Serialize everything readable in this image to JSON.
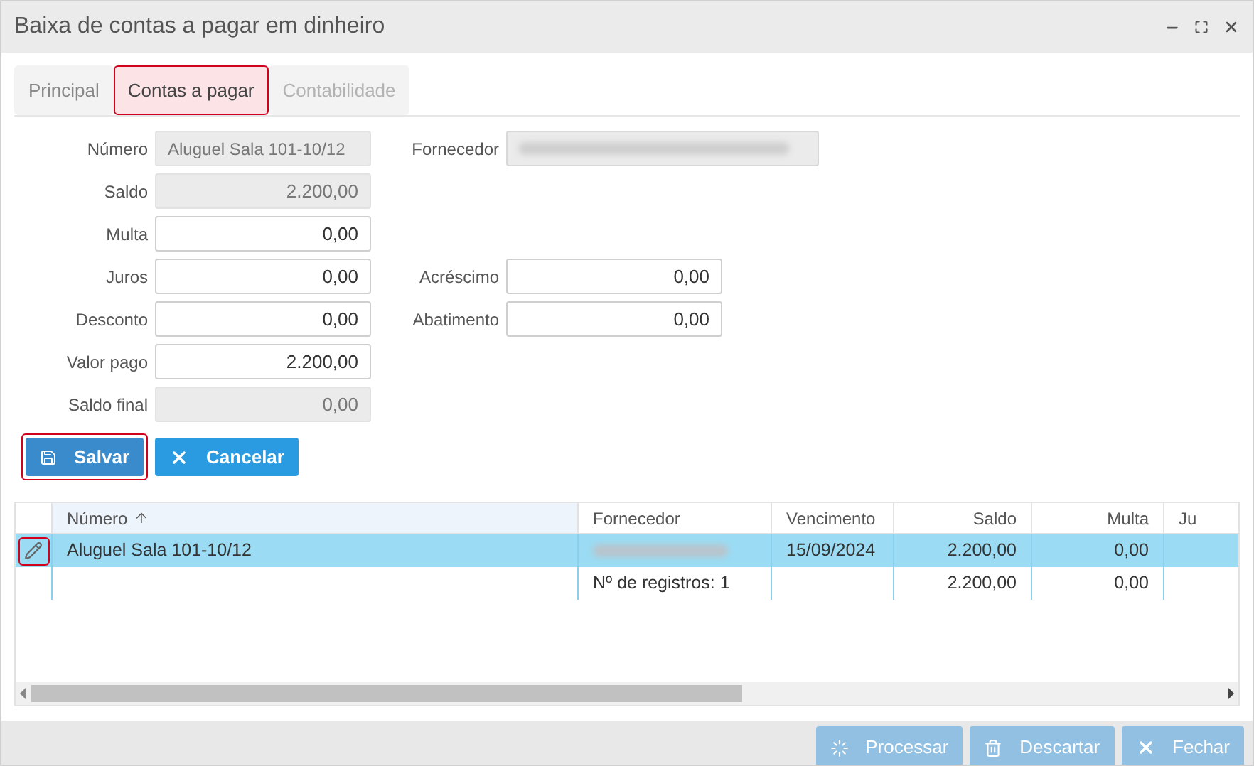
{
  "window": {
    "title": "Baixa de contas a pagar em dinheiro"
  },
  "tabs": [
    {
      "label": "Principal",
      "selected": false,
      "disabled": false,
      "highlighted": false
    },
    {
      "label": "Contas a pagar",
      "selected": true,
      "disabled": false,
      "highlighted": true
    },
    {
      "label": "Contabilidade",
      "selected": false,
      "disabled": true,
      "highlighted": false
    }
  ],
  "form_rows": [
    {
      "left": {
        "label": "Número",
        "value": "Aluguel Sala 101-10/12",
        "readonly": true
      },
      "right": {
        "label": "Fornecedor",
        "kind": "redacted",
        "readonly": true
      }
    },
    {
      "left": {
        "label": "Saldo",
        "value": "2.200,00",
        "readonly": true
      }
    },
    {
      "left": {
        "label": "Multa",
        "value": "0,00",
        "readonly": false
      }
    },
    {
      "left": {
        "label": "Juros",
        "value": "0,00",
        "readonly": false
      },
      "right": {
        "label": "Acréscimo",
        "kind": "text",
        "value": "0,00",
        "readonly": false
      }
    },
    {
      "left": {
        "label": "Desconto",
        "value": "0,00",
        "readonly": false
      },
      "right": {
        "label": "Abatimento",
        "kind": "text",
        "value": "0,00",
        "readonly": false
      }
    },
    {
      "left": {
        "label": "Valor pago",
        "value": "2.200,00",
        "readonly": false
      }
    },
    {
      "left": {
        "label": "Saldo final",
        "value": "0,00",
        "readonly": true
      }
    }
  ],
  "form_buttons": [
    {
      "label": "Salvar",
      "kind": "save",
      "highlighted": true
    },
    {
      "label": "Cancelar",
      "kind": "cancel",
      "highlighted": false
    }
  ],
  "table": {
    "columns": [
      {
        "label": "Número",
        "sorted": true
      },
      {
        "label": "Fornecedor",
        "sorted": false
      },
      {
        "label": "Vencimento",
        "sorted": false
      },
      {
        "label": "Saldo",
        "sorted": false
      },
      {
        "label": "Multa",
        "sorted": false
      },
      {
        "label": "Ju",
        "sorted": false
      }
    ],
    "rows": [
      {
        "selected": true,
        "edit_highlighted": true,
        "cells": [
          {
            "kind": "text",
            "text": "Aluguel Sala 101-10/12"
          },
          {
            "kind": "redacted"
          },
          {
            "kind": "text",
            "text": "15/09/2024"
          },
          {
            "kind": "text",
            "text": "2.200,00"
          },
          {
            "kind": "text",
            "text": "0,00"
          },
          {
            "kind": "empty"
          }
        ]
      }
    ],
    "summary": [
      {
        "kind": "empty"
      },
      {
        "kind": "text",
        "text": "Nº de registros: 1"
      },
      {
        "kind": "empty"
      },
      {
        "kind": "text",
        "text": "2.200,00"
      },
      {
        "kind": "text",
        "text": "0,00"
      },
      {
        "kind": "empty"
      }
    ]
  },
  "footer_buttons": [
    {
      "label": "Processar",
      "kind": "process",
      "disabled": true
    },
    {
      "label": "Descartar",
      "kind": "discard",
      "disabled": true
    },
    {
      "label": "Fechar",
      "kind": "close",
      "disabled": true
    }
  ]
}
